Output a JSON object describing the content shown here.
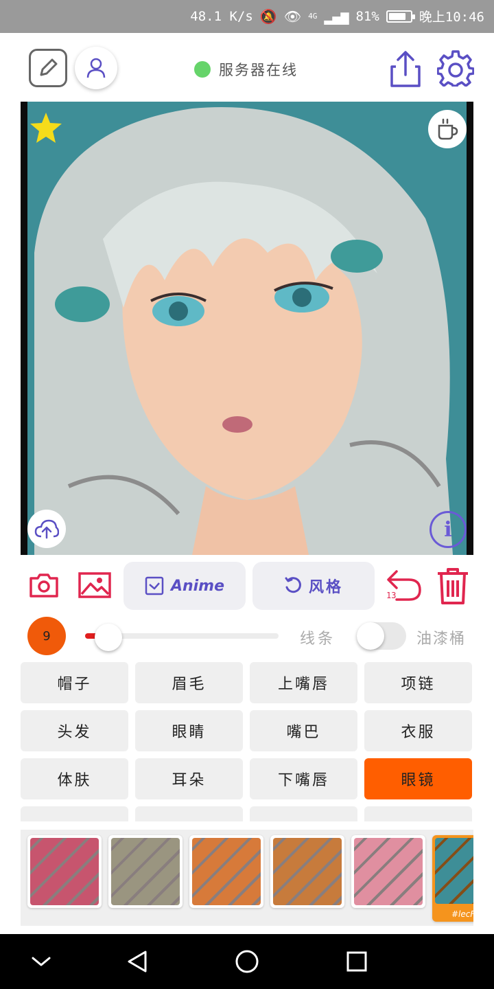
{
  "status_bar": {
    "speed": "48.1 K/s",
    "network": "4G",
    "battery": "81%",
    "battery_level": 0.81,
    "time": "晚上10:46"
  },
  "header": {
    "server_status": "服务器在线",
    "server_status_color": "#66d46a"
  },
  "artwork": {
    "background_color": "#3e8e97",
    "info_label": "i"
  },
  "actions": {
    "anime_label": "Anime",
    "style_label": "风格",
    "undo_count": "13",
    "accent_color": "#5a4fc4",
    "danger_color": "#e0264f"
  },
  "brush": {
    "size": "9",
    "slider_value": 0.12,
    "lines_label": "线条",
    "bucket_label": "油漆桶",
    "bucket_enabled": false
  },
  "parts": [
    {
      "label": "帽子",
      "active": false
    },
    {
      "label": "眉毛",
      "active": false
    },
    {
      "label": "上嘴唇",
      "active": false
    },
    {
      "label": "项链",
      "active": false
    },
    {
      "label": "头发",
      "active": false
    },
    {
      "label": "眼睛",
      "active": false
    },
    {
      "label": "嘴巴",
      "active": false
    },
    {
      "label": "衣服",
      "active": false
    },
    {
      "label": "体肤",
      "active": false
    },
    {
      "label": "耳朵",
      "active": false
    },
    {
      "label": "下嘴唇",
      "active": false
    },
    {
      "label": "眼镜",
      "active": true
    }
  ],
  "styles": {
    "items": [
      {
        "color": "#c7556e",
        "selected": false
      },
      {
        "color": "#9a9580",
        "selected": false
      },
      {
        "color": "#d77a3a",
        "selected": false
      },
      {
        "color": "#c77b3c",
        "selected": false
      },
      {
        "color": "#e08fa0",
        "selected": false
      },
      {
        "color": "#3e8e97",
        "selected": true
      }
    ],
    "selected_label": "#lecF"
  }
}
